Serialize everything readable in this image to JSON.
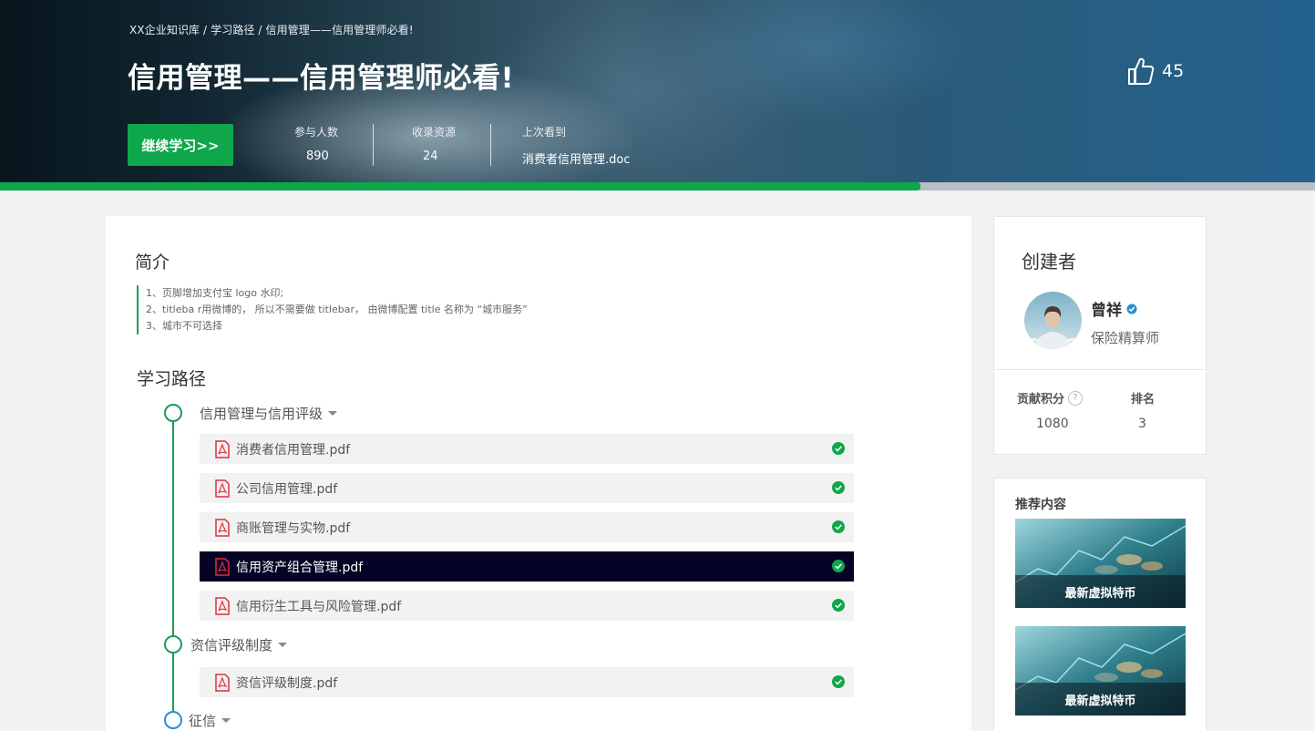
{
  "hero": {
    "breadcrumb": "XX企业知识库 / 学习路径 / 信用管理——信用管理师必看!",
    "title": "信用管理——信用管理师必看!",
    "likes": "45",
    "continue_label": "继续学习>>",
    "stats": [
      {
        "label": "参与人数",
        "value": "890"
      },
      {
        "label": "收录资源",
        "value": "24"
      },
      {
        "label": "上次看到",
        "value": "消费者信用管理.doc"
      }
    ],
    "progress": 0.7
  },
  "main": {
    "intro_title": "简介",
    "intro_lines": [
      "1、页脚增加支付宝 logo 水印;",
      "2、titleba r用微博的， 所以不需要做 titlebar， 由微博配置 title 名称为 “城市服务”",
      "3、城市不可选择"
    ],
    "path_title": "学习路径",
    "groups": [
      {
        "name": "信用管理与信用评级",
        "files": [
          {
            "name": "消费者信用管理.pdf",
            "done": true
          },
          {
            "name": "公司信用管理.pdf",
            "done": true
          },
          {
            "name": "商账管理与实物.pdf",
            "done": true
          },
          {
            "name": "信用资产组合管理.pdf",
            "done": true,
            "active": true
          },
          {
            "name": "信用衍生工具与风险管理.pdf",
            "done": true
          }
        ]
      },
      {
        "name": "资信评级制度",
        "files": [
          {
            "name": "资信评级制度.pdf",
            "done": true
          }
        ]
      },
      {
        "name": "征信",
        "files": []
      }
    ]
  },
  "creator": {
    "title": "创建者",
    "name": "曾祥",
    "role": "保险精算师",
    "points_label": "贡献积分",
    "points": "1080",
    "rank_label": "排名",
    "rank": "3"
  },
  "recommend": {
    "title": "推荐内容",
    "items": [
      {
        "caption": "最新虚拟特币"
      },
      {
        "caption": "最新虚拟特币"
      }
    ]
  },
  "colors": {
    "accent": "#0ea74b",
    "active_row": "#050325",
    "timeline": "#1d9b5c",
    "verified": "#2a8fd6"
  }
}
